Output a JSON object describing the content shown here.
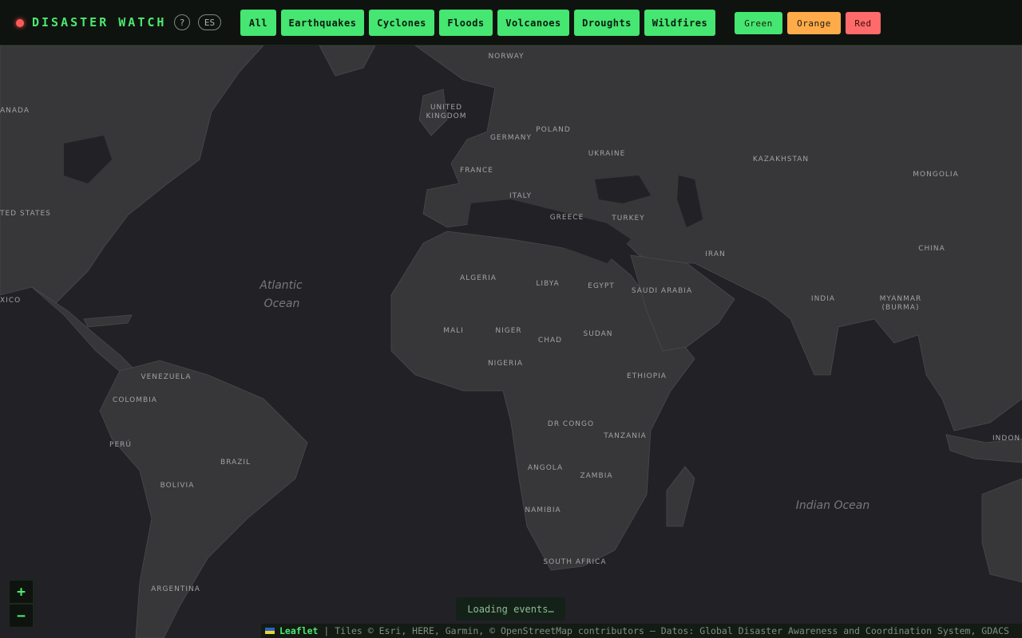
{
  "app": {
    "title": "DISASTER WATCH",
    "help_label": "?",
    "lang_label": "ES"
  },
  "filters": [
    {
      "label": "All"
    },
    {
      "label": "Earthquakes"
    },
    {
      "label": "Cyclones"
    },
    {
      "label": "Floods"
    },
    {
      "label": "Volcanoes"
    },
    {
      "label": "Droughts"
    },
    {
      "label": "Wildfires"
    }
  ],
  "alert_levels": [
    {
      "label": "Green",
      "color": "#45e671"
    },
    {
      "label": "Orange",
      "color": "#ffab4a"
    },
    {
      "label": "Red",
      "color": "#ff6a6a"
    }
  ],
  "map": {
    "countries": [
      "NORWAY",
      "UNITED",
      "KINGDOM",
      "POLAND",
      "GERMANY",
      "UKRAINE",
      "FRANCE",
      "KAZAKHSTAN",
      "MONGOLIA",
      "ITALY",
      "GREECE",
      "TURKEY",
      "CHINA",
      "IRAN",
      "ALGERIA",
      "LIBYA",
      "EGYPT",
      "SAUDI ARABIA",
      "INDIA",
      "MYANMAR",
      "(BURMA)",
      "MALI",
      "NIGER",
      "SUDAN",
      "CHAD",
      "NIGERIA",
      "ETHIOPIA",
      "VENEZUELA",
      "COLOMBIA",
      "DR CONGO",
      "TANZANIA",
      "PERÚ",
      "BRAZIL",
      "ANGOLA",
      "ZAMBIA",
      "BOLIVIA",
      "NAMIBIA",
      "SOUTH AFRICA",
      "ARGENTINA",
      "ANADA",
      "TED STATES",
      "XICO",
      "INDON"
    ],
    "oceans": [
      "Atlantic",
      "Ocean",
      "Indian Ocean"
    ]
  },
  "zoom": {
    "in": "+",
    "out": "−"
  },
  "status": "Loading events…",
  "attribution": {
    "leaflet": "Leaflet",
    "text": " | Tiles © Esri, HERE, Garmin, © OpenStreetMap contributors — Datos: Global Disaster Awareness and Coordination System, GDACS"
  }
}
